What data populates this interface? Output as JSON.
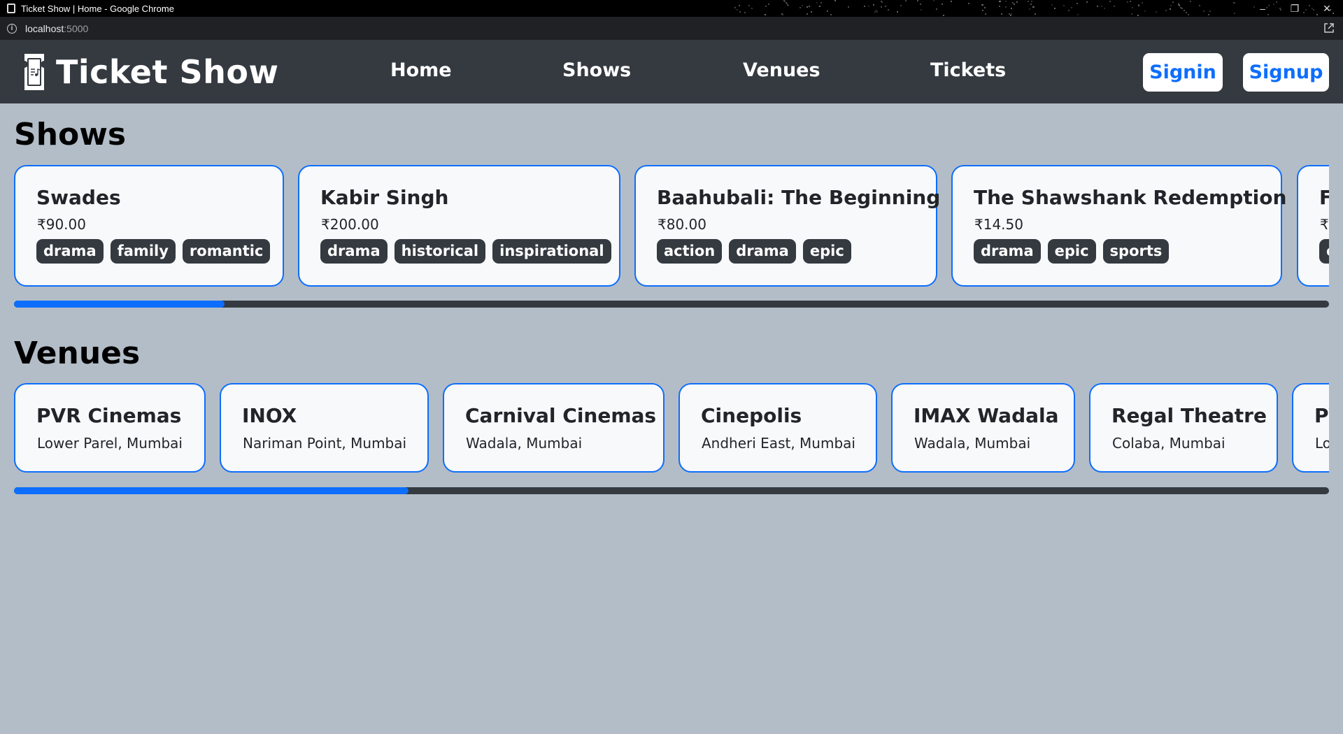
{
  "browser": {
    "window_title": "Ticket Show | Home - Google Chrome",
    "url_host": "localhost",
    "url_port": ":5000"
  },
  "navbar": {
    "brand": "Ticket Show",
    "links": [
      "Home",
      "Shows",
      "Venues",
      "Tickets"
    ],
    "signin_label": "Signin",
    "signup_label": "Signup"
  },
  "shows": {
    "title": "Shows",
    "items": [
      {
        "name": "Swades",
        "price": "₹90.00",
        "tags": [
          "drama",
          "family",
          "romantic"
        ]
      },
      {
        "name": "Kabir Singh",
        "price": "₹200.00",
        "tags": [
          "drama",
          "historical",
          "inspirational"
        ]
      },
      {
        "name": "Baahubali: The Beginning",
        "price": "₹80.00",
        "tags": [
          "action",
          "drama",
          "epic"
        ]
      },
      {
        "name": "The Shawshank Redemption",
        "price": "₹14.50",
        "tags": [
          "drama",
          "epic",
          "sports"
        ]
      },
      {
        "name": "F",
        "price": "₹",
        "tags": [
          "c"
        ]
      }
    ],
    "scroll_fraction": 0.16
  },
  "venues": {
    "title": "Venues",
    "items": [
      {
        "name": "PVR Cinemas",
        "location": "Lower Parel, Mumbai"
      },
      {
        "name": "INOX",
        "location": "Nariman Point, Mumbai"
      },
      {
        "name": "Carnival Cinemas",
        "location": "Wadala, Mumbai"
      },
      {
        "name": "Cinepolis",
        "location": "Andheri East, Mumbai"
      },
      {
        "name": "IMAX Wadala",
        "location": "Wadala, Mumbai"
      },
      {
        "name": "Regal Theatre",
        "location": "Colaba, Mumbai"
      },
      {
        "name": "PV",
        "location": "Lo"
      }
    ],
    "scroll_fraction": 0.3
  },
  "colors": {
    "accent": "#0d6efd",
    "navbar": "#343a40",
    "page_bg": "#b3bdc7",
    "card_bg": "#f8f9fa"
  }
}
